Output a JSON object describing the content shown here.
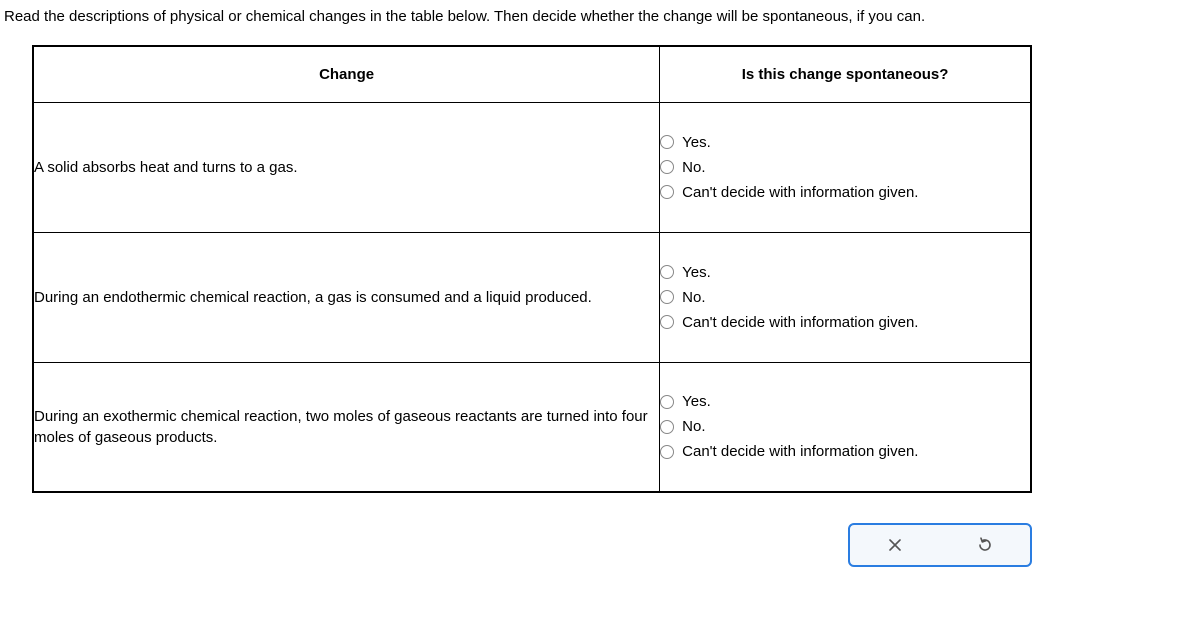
{
  "instructions": "Read the descriptions of physical or chemical changes in the table below. Then decide whether the change will be spontaneous, if you can.",
  "headers": {
    "change": "Change",
    "spontaneous": "Is this change spontaneous?"
  },
  "rows": [
    {
      "change": "A solid absorbs heat and turns to a gas.",
      "options": {
        "yes": "Yes.",
        "no": "No.",
        "cant": "Can't decide with information given."
      }
    },
    {
      "change": "During an endothermic chemical reaction, a gas is consumed and a liquid produced.",
      "options": {
        "yes": "Yes.",
        "no": "No.",
        "cant": "Can't decide with information given."
      }
    },
    {
      "change": "During an exothermic chemical reaction, two moles of gaseous reactants are turned into four moles of gaseous products.",
      "options": {
        "yes": "Yes.",
        "no": "No.",
        "cant": "Can't decide with information given."
      }
    }
  ]
}
